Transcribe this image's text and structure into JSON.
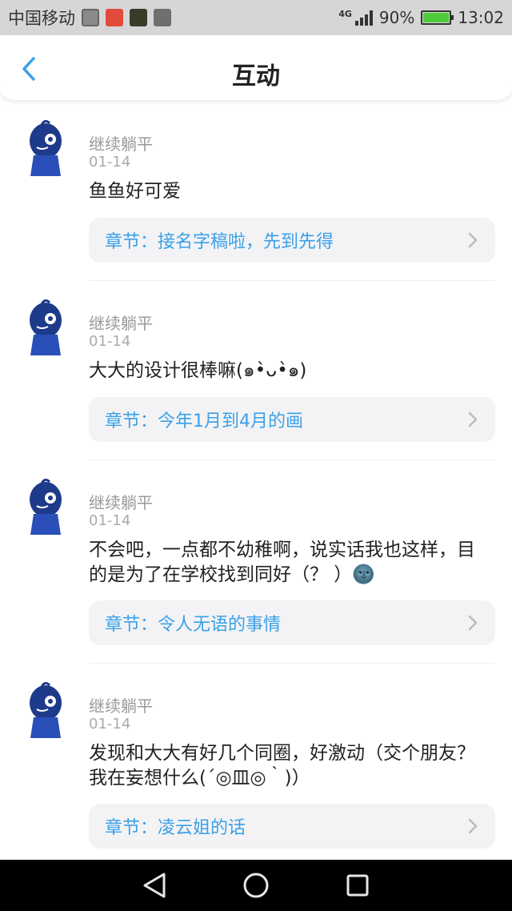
{
  "status_bar": {
    "carrier": "中国移动",
    "network": "4G",
    "battery": "90%",
    "time": "13:02"
  },
  "header": {
    "title": "互动"
  },
  "comments": [
    {
      "username": "继续躺平",
      "date": "01-14",
      "content": "鱼鱼好可爱",
      "chapter": "章节：接名字稿啦，先到先得"
    },
    {
      "username": "继续躺平",
      "date": "01-14",
      "content": "大大的设计很棒嘛(๑•̀ᴗ•̀๑)",
      "chapter": "章节：今年1月到4月的画"
    },
    {
      "username": "继续躺平",
      "date": "01-14",
      "content": "不会吧，一点都不幼稚啊，说实话我也这样，目的是为了在学校找到同好（？ ）🌚",
      "chapter": "章节：令人无语的事情"
    },
    {
      "username": "继续躺平",
      "date": "01-14",
      "content": "发现和大大有好几个同圈，好激动（交个朋友？我在妄想什么(´◎皿◎｀)）",
      "chapter": "章节：凌云姐的话"
    }
  ],
  "colors": {
    "accent": "#3aa0e8",
    "chapter_bg": "#f3f3f5",
    "status_bg": "#d6d6d6"
  }
}
